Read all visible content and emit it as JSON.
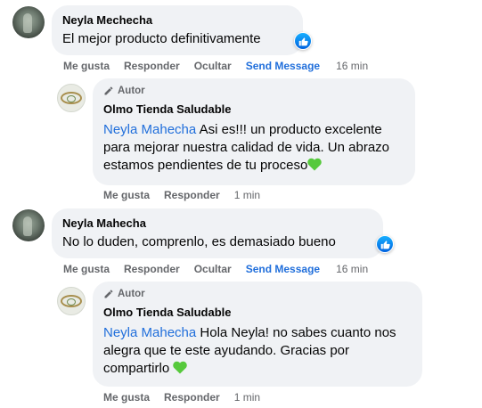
{
  "comments": [
    {
      "author": "Neyla Mechecha",
      "text": "El mejor producto definitivamente",
      "actions": {
        "like": "Me gusta",
        "reply": "Responder",
        "hide": "Ocultar",
        "send": "Send Message",
        "time": "16 min"
      },
      "reaction_icon": "like-icon"
    },
    {
      "badge": "Autor",
      "author": "Olmo Tienda Saludable",
      "mention": "Neyla Mahecha",
      "text": " Asi es!!! un producto excelente para mejorar nuestra calidad de vida. Un abrazo estamos pendientes de tu proceso",
      "emoji": "green-heart",
      "actions": {
        "like": "Me gusta",
        "reply": "Responder",
        "time": "1 min"
      }
    },
    {
      "author": "Neyla Mahecha",
      "text": "No lo duden, comprenlo, es demasiado bueno",
      "actions": {
        "like": "Me gusta",
        "reply": "Responder",
        "hide": "Ocultar",
        "send": "Send Message",
        "time": "16 min"
      },
      "reaction_icon": "like-icon"
    },
    {
      "badge": "Autor",
      "author": "Olmo Tienda Saludable",
      "mention": "Neyla Mahecha",
      "text": " Hola Neyla! no sabes cuanto nos alegra que te este ayudando. Gracias por compartirlo",
      "emoji": "green-heart",
      "actions": {
        "like": "Me gusta",
        "reply": "Responder",
        "time": "1 min"
      }
    }
  ],
  "colors": {
    "bubble": "#f0f2f5",
    "link": "#216fdb",
    "muted": "#65676b",
    "heart": "#56c93c"
  }
}
